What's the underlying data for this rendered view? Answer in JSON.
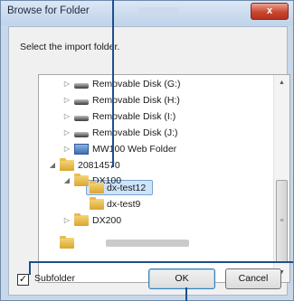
{
  "window": {
    "title": "Browse for Folder",
    "close_glyph": "x"
  },
  "prompt": "Select the import folder.",
  "tree": {
    "rows": [
      {
        "label": "Removable Disk (G:)",
        "icon": "drive-icon",
        "expander": "collapsed"
      },
      {
        "label": "Removable Disk (H:)",
        "icon": "drive-icon",
        "expander": "collapsed"
      },
      {
        "label": "Removable Disk (I:)",
        "icon": "drive-icon",
        "expander": "collapsed"
      },
      {
        "label": "Removable Disk (J:)",
        "icon": "drive-icon",
        "expander": "collapsed"
      },
      {
        "label": "MW100 Web Folder",
        "icon": "web-folder-icon",
        "expander": "collapsed"
      },
      {
        "label": "20814570",
        "icon": "folder-icon",
        "expander": "expanded"
      },
      {
        "label": "DX100",
        "icon": "folder-icon",
        "expander": "expanded"
      },
      {
        "label": "dx-test12",
        "icon": "folder-icon",
        "expander": "none",
        "selected": true
      },
      {
        "label": "dx-test9",
        "icon": "folder-icon",
        "expander": "none"
      },
      {
        "label": "DX200",
        "icon": "folder-icon",
        "expander": "collapsed"
      },
      {
        "label": "",
        "icon": "folder-icon",
        "expander": "none",
        "obscured": true
      }
    ]
  },
  "scrollbar": {
    "up": "▲",
    "down": "▼",
    "grip": "≡"
  },
  "subfolder": {
    "label": "Subfolder",
    "checked": true,
    "mark": "✓"
  },
  "buttons": {
    "ok": "OK",
    "cancel": "Cancel"
  },
  "glyphs": {
    "collapsed": "▷",
    "expanded": "◢"
  },
  "colors": {
    "selection": "#cde4fb",
    "callout": "#1d4f8d",
    "title_bar": "#c8d8ea"
  }
}
